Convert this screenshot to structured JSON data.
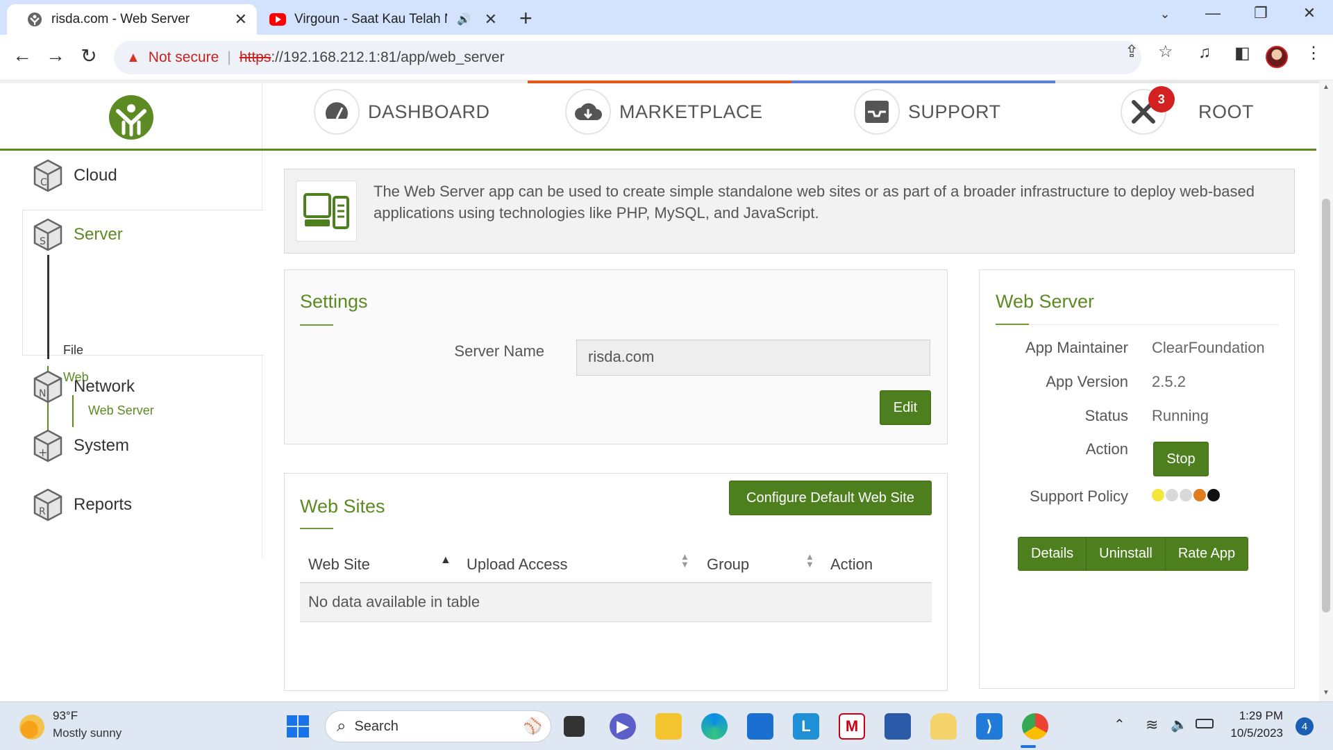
{
  "browser": {
    "tabs": [
      {
        "title": "risda.com - Web Server",
        "active": true
      },
      {
        "title": "Virgoun - Saat Kau Telah Me",
        "active": false
      }
    ],
    "address": {
      "warning": "Not secure",
      "protocol": "https",
      "rest": "://192.168.212.1:81/app/web_server"
    }
  },
  "header": {
    "nav": [
      {
        "label": "DASHBOARD"
      },
      {
        "label": "MARKETPLACE"
      },
      {
        "label": "SUPPORT"
      },
      {
        "label": "ROOT",
        "badge": "3"
      }
    ]
  },
  "sidebar": {
    "sections": [
      {
        "label": "Cloud",
        "letter": "C"
      },
      {
        "label": "Server",
        "letter": "S"
      },
      {
        "label": "Network",
        "letter": "N"
      },
      {
        "label": "System",
        "letter": "+"
      },
      {
        "label": "Reports",
        "letter": "R"
      }
    ],
    "server_sub": {
      "file": "File",
      "web": "Web",
      "web_server": "Web Server"
    }
  },
  "intro": {
    "text": "The Web Server app can be used to create simple standalone web sites or as part of a broader infrastructure to deploy web-based applications using technologies like PHP, MySQL, and JavaScript."
  },
  "settings": {
    "title": "Settings",
    "server_name_label": "Server Name",
    "server_name_value": "risda.com",
    "edit_label": "Edit"
  },
  "websites": {
    "title": "Web Sites",
    "configure_label": "Configure Default Web Site",
    "columns": [
      "Web Site",
      "Upload Access",
      "Group",
      "Action"
    ],
    "empty": "No data available in table"
  },
  "appinfo": {
    "title": "Web Server",
    "maintainer_label": "App Maintainer",
    "maintainer": "ClearFoundation",
    "version_label": "App Version",
    "version": "2.5.2",
    "status_label": "Status",
    "status": "Running",
    "action_label": "Action",
    "stop_label": "Stop",
    "support_label": "Support Policy",
    "support_dots": [
      "#f5e63a",
      "#d9d9d9",
      "#d9d9d9",
      "#e07b1f",
      "#111111"
    ],
    "buttons": [
      "Details",
      "Uninstall",
      "Rate App"
    ]
  },
  "taskbar": {
    "weather_temp": "93°F",
    "weather_desc": "Mostly sunny",
    "search_placeholder": "Search",
    "time": "1:29 PM",
    "date": "10/5/2023",
    "notifications": "4"
  },
  "colors": {
    "accent_green": "#5c8a23",
    "button_green": "#4e7f1f",
    "badge_red": "#d32020"
  }
}
